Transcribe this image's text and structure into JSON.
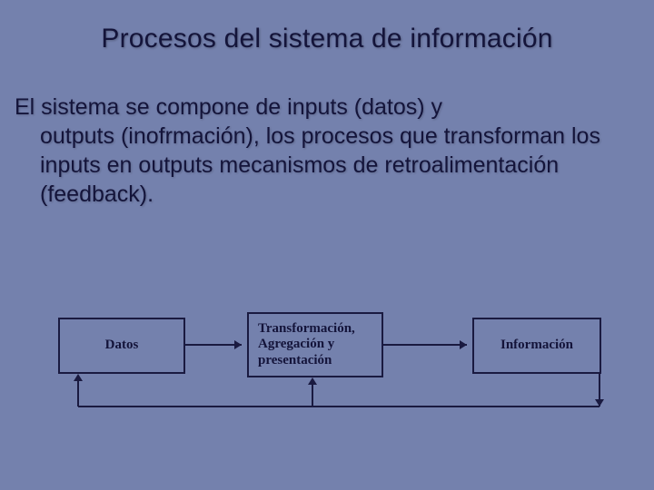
{
  "title": "Procesos del sistema de información",
  "paragraph_line1": "El sistema se compone de inputs (datos) y",
  "paragraph_rest": "outputs (inofrmación), los procesos que transforman los inputs en outputs mecanismos de retroalimentación (feedback).",
  "diagram": {
    "box1": "Datos",
    "box2": "Transformación, Agregación y presentación",
    "box3": "Información"
  }
}
